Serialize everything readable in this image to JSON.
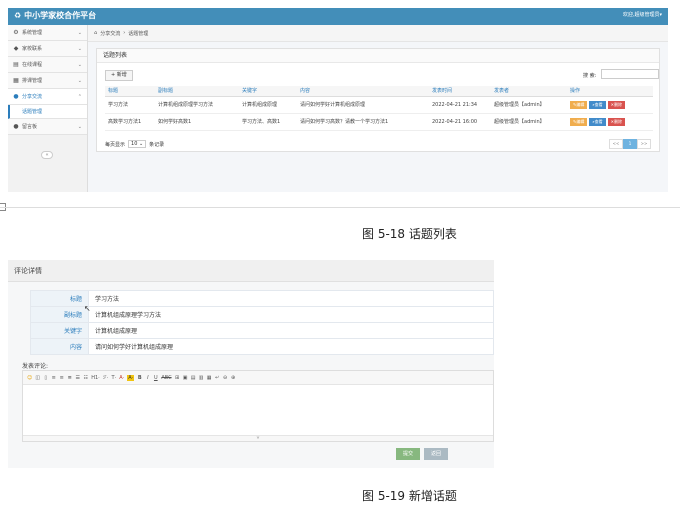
{
  "shot1": {
    "app_title": "中小学家校合作平台",
    "user_text": "欢迎,超级管理员▾",
    "sidebar": [
      {
        "icon": "gear-icon",
        "glyph": "⚙",
        "label": "系统管理"
      },
      {
        "icon": "tag-icon",
        "glyph": "◆",
        "label": "家校联系"
      },
      {
        "icon": "book-icon",
        "glyph": "▤",
        "label": "在线课程"
      },
      {
        "icon": "calendar-icon",
        "glyph": "▦",
        "label": "排课管理"
      },
      {
        "icon": "chat-icon",
        "glyph": "●",
        "label": "分享交流"
      }
    ],
    "sidebar_sub": "话题管理",
    "sidebar_last": {
      "icon": "comment-icon",
      "glyph": "●",
      "label": "留言板"
    },
    "breadcrumb": [
      "分享交流",
      "话题管理"
    ],
    "panel_title": "话题列表",
    "add_button": "+ 新增",
    "search_label": "搜 索:",
    "table": {
      "headers": [
        "标题",
        "副标题",
        "关键字",
        "内容",
        "发表时间",
        "发表者",
        "操作"
      ],
      "rows": [
        [
          "学习方法",
          "计算机组成原理学习方法",
          "计算机组成原理",
          "请问如何学好计算机组成原理",
          "2022-04-21 21:34",
          "超级管理员【admin】"
        ],
        [
          "高数学习方法1",
          "如何学好高数1",
          "学习方法、高数1",
          "请问如何学习高数？请教一个学习方法1",
          "2022-04-21 16:00",
          "超级管理员【admin】"
        ]
      ],
      "ops": [
        "编辑",
        "查看",
        "删除"
      ]
    },
    "pager": {
      "show_label": "每页显示",
      "page_size": "10",
      "records_label": "条记录",
      "prev": "<<",
      "current": "1",
      "next": ">>"
    }
  },
  "caption1": "图 5-18 话题列表",
  "shot2": {
    "title": "评论详情",
    "fields": [
      {
        "label": "标题",
        "value": "学习方法"
      },
      {
        "label": "副标题",
        "value": "计算机组成原理学习方法"
      },
      {
        "label": "关键字",
        "value": "计算机组成原理"
      },
      {
        "label": "内容",
        "value": "请问如何学好计算机组成原理"
      }
    ],
    "comment_label": "发表评论:",
    "toolbar": [
      "☺",
      "◫",
      "▯",
      "≡",
      "≡",
      "≣",
      "☰",
      "☷",
      "H1·",
      "ℱ·",
      "T·",
      "A·",
      "A·",
      "B",
      "I",
      "U",
      "ABC",
      "⊞",
      "▣",
      "▤",
      "▥",
      "▦",
      "↵",
      "⊖",
      "⊕"
    ],
    "submit": "提交",
    "back": "返回"
  },
  "caption2": "图 5-19 新增话题"
}
